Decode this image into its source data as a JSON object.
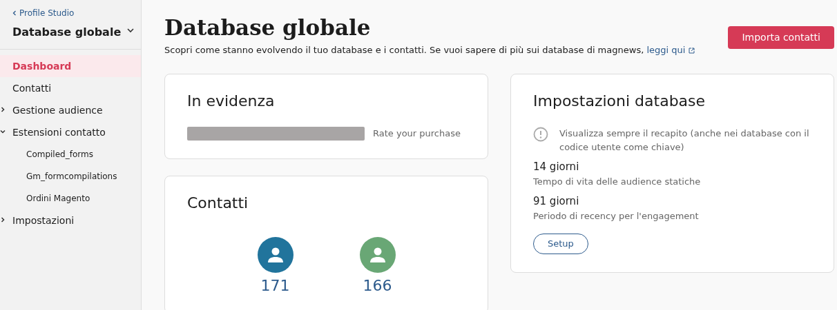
{
  "sidebar": {
    "back_link": "Profile Studio",
    "title": "Database globale",
    "items": [
      {
        "label": "Dashboard",
        "selected": true
      },
      {
        "label": "Contatti",
        "selected": false
      },
      {
        "label": "Gestione audience",
        "selected": false,
        "expanded": false
      },
      {
        "label": "Estensioni contatto",
        "selected": false,
        "expanded": true,
        "children": [
          {
            "label": "Compiled_forms",
            "selected": false
          },
          {
            "label": "Gm_formcompilations",
            "selected": false
          },
          {
            "label": "Ordini Magento",
            "selected": false
          }
        ]
      },
      {
        "label": "Impostazioni",
        "selected": false,
        "expanded": false
      }
    ]
  },
  "header": {
    "title": "Database globale",
    "description": "Scopri come stanno evolvendo il tuo database e i contatti. Se vuoi sapere di più sui database di magnews,",
    "link": "leggi qui",
    "button": "Importa contatti"
  },
  "highlight_card": {
    "title": "In evidenza",
    "caption": "Rate your purchase"
  },
  "contacts_card": {
    "title": "Contatti",
    "stats": [
      {
        "value": "171",
        "color": "#21749c"
      },
      {
        "value": "166",
        "color": "#69a775"
      }
    ]
  },
  "settings_card": {
    "title": "Impostazioni database",
    "notice": "Visualizza sempre il recapito (anche nei database con il codice utente come chiave)",
    "settings": [
      {
        "value": "14 giorni",
        "label": "Tempo di vita delle audience statiche"
      },
      {
        "value": "91 giorni",
        "label": "Periodo di recency per l'engagement"
      }
    ],
    "button": "Setup"
  }
}
